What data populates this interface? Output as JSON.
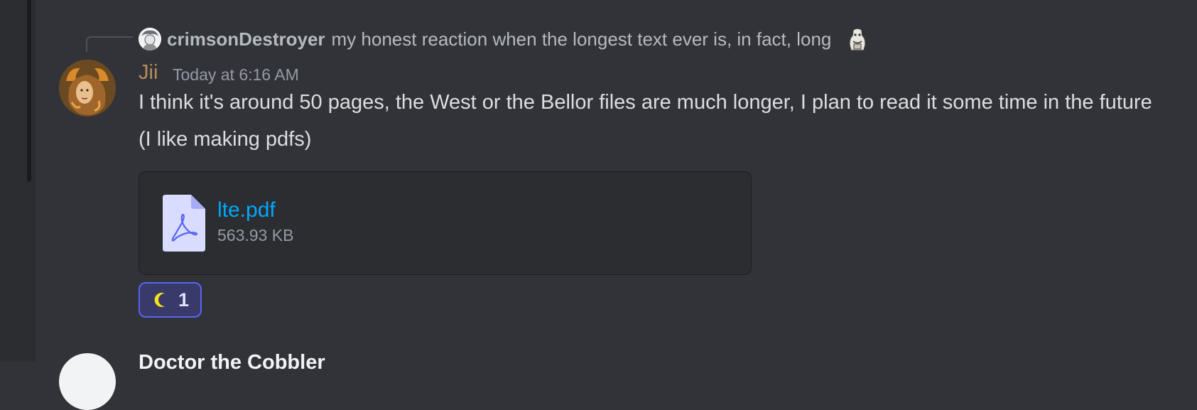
{
  "reply": {
    "author": "crimsonDestroyer",
    "text": "my honest reaction when the longest text ever is, in fact, long"
  },
  "message": {
    "author": "Jii",
    "author_color": "#b68d5a",
    "timestamp": "Today at 6:16 AM",
    "lines": [
      "I think it's around 50 pages, the West or the Bellor files are much longer, I plan to read it some time in the future",
      "(I like making pdfs)"
    ],
    "attachment": {
      "icon": "pdf-file-icon",
      "name": "lte.pdf",
      "size": "563.93 KB"
    },
    "reactions": [
      {
        "emoji": "crescent-moon-icon",
        "count": "1"
      }
    ]
  },
  "next_message": {
    "author": "Doctor the Cobbler"
  },
  "colors": {
    "background": "#313338",
    "link": "#00a8fc",
    "reaction_border": "#5865f2"
  }
}
